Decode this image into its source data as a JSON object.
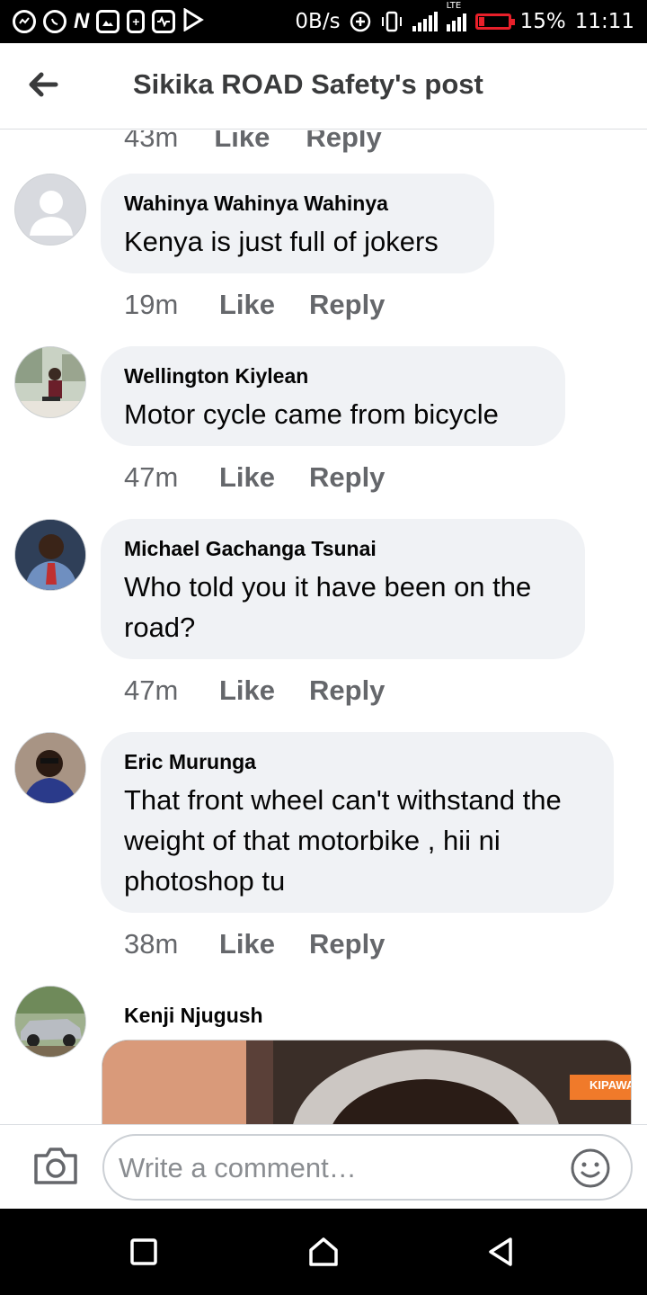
{
  "status_bar": {
    "data_rate": "0B/s",
    "network_label": "LTE",
    "battery_percent": "15%",
    "time": "11:11",
    "left_icons": [
      "messenger-icon",
      "whatsapp-icon",
      "n-app-icon",
      "gallery-icon",
      "battery-saver-icon",
      "activity-icon",
      "play-store-icon"
    ]
  },
  "header": {
    "title": "Sikika ROAD Safety's post"
  },
  "partial_comment": {
    "time": "43m",
    "like_label": "Like",
    "reply_label": "Reply"
  },
  "comments": [
    {
      "author": "Wahinya Wahinya Wahinya",
      "text": "Kenya is just full of jokers",
      "time": "19m",
      "like_label": "Like",
      "reply_label": "Reply"
    },
    {
      "author": "Wellington Kiylean",
      "text": "Motor cycle came from bicycle",
      "time": "47m",
      "like_label": "Like",
      "reply_label": "Reply"
    },
    {
      "author": "Michael Gachanga Tsunai",
      "text": "Who told you it have been on the road?",
      "time": "47m",
      "like_label": "Like",
      "reply_label": "Reply"
    },
    {
      "author": "Eric Murunga",
      "text": "That front wheel can't withstand the weight of that motorbike , hii ni photoshop tu",
      "time": "38m",
      "like_label": "Like",
      "reply_label": "Reply"
    },
    {
      "author": "Kenji Njugush",
      "attachment_label": "KIPAWA"
    }
  ],
  "composer": {
    "placeholder": "Write a comment…"
  },
  "colors": {
    "bubble": "#f0f2f5",
    "meta_text": "#65676b",
    "title_text": "#3a3b3c",
    "battery_low": "#e8202a"
  }
}
